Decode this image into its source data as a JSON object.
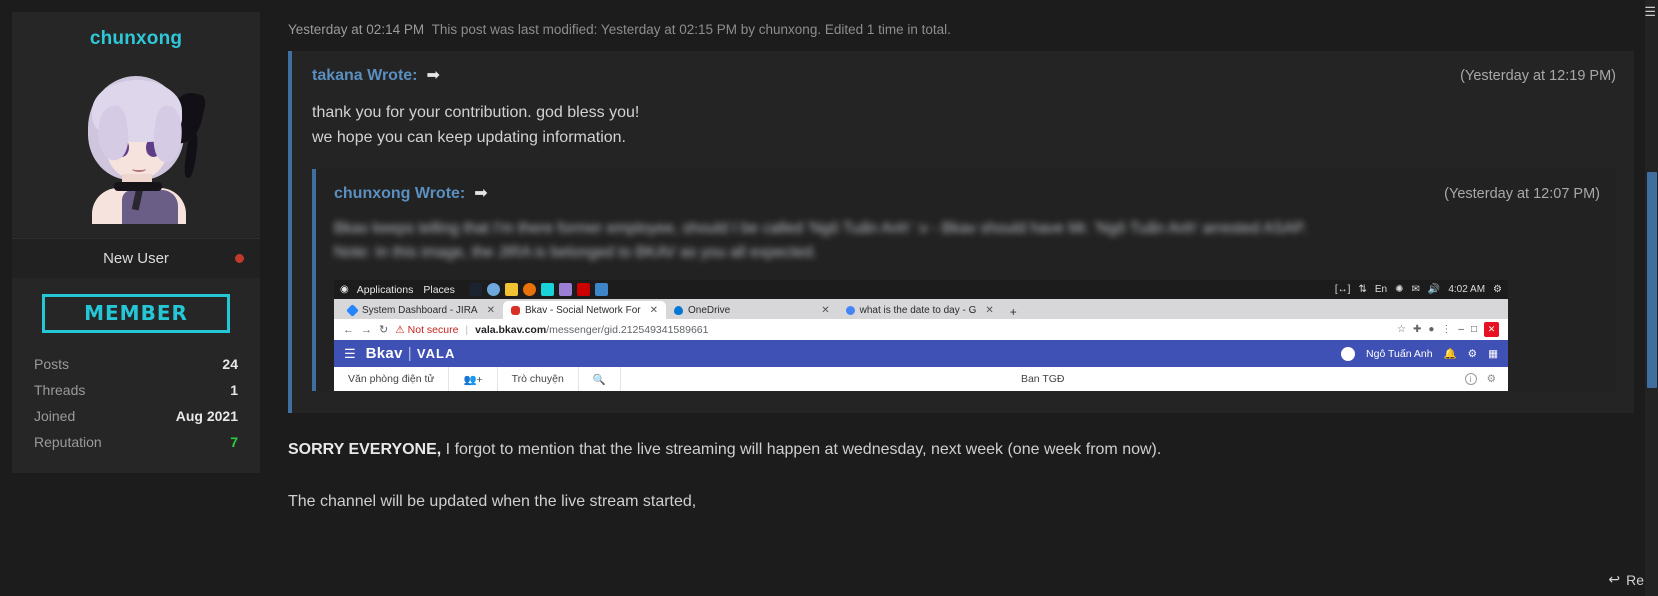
{
  "author": {
    "name": "chunxong",
    "avatar_alt": "anime-girl-avatar",
    "status": "New User",
    "badge": "MEMBER",
    "stats": [
      {
        "label": "Posts",
        "value": "24",
        "kind": "plain"
      },
      {
        "label": "Threads",
        "value": "1",
        "kind": "plain"
      },
      {
        "label": "Joined",
        "value": "Aug 2021",
        "kind": "plain"
      },
      {
        "label": "Reputation",
        "value": "7",
        "kind": "reputation"
      }
    ]
  },
  "post": {
    "timestamp": "Yesterday at 02:14 PM",
    "edit_note": "This post was last modified: Yesterday at 02:15 PM by chunxong. Edited 1 time in total.",
    "paragraphs": [
      {
        "bold": "SORRY EVERYONE,",
        "rest": " I forgot to mention that the live streaming will happen at wednesday, next week (one week from now)."
      },
      {
        "bold": "",
        "rest": "The channel will be updated when the live stream started,"
      }
    ]
  },
  "quote_outer": {
    "author": "takana Wrote:",
    "arrow": "➡",
    "timestamp": "(Yesterday at 12:19 PM)",
    "lines": [
      "thank you for your contribution. god bless you!",
      "we hope you can keep updating information."
    ]
  },
  "quote_inner": {
    "author": "chunxong Wrote:",
    "arrow": "➡",
    "timestamp": "(Yesterday at 12:07 PM)",
    "redacted_lines": [
      "Bkav keeps telling that I'm there former employee, should I be called 'Ngô Tuấn Anh' :v - Bkav should have Mr. 'Ngô Tuấn Anh' arrested ASAP.",
      "Note: In this image, the JIRA is belonged to BKAV as you all expected."
    ]
  },
  "screenshot": {
    "desktop_panel": {
      "activities": "Applications",
      "places": "Places",
      "clock": "4:02 AM",
      "keyboard": "En",
      "tray_icons": [
        "resize-icon",
        "network-icon",
        "bluetooth-icon",
        "mail-icon",
        "volume-icon",
        "power-icon"
      ]
    },
    "browser_tabs": [
      {
        "title": "System Dashboard - JIRA",
        "favicon": "#2684ff",
        "active": false
      },
      {
        "title": "Bkav - Social Network For",
        "favicon": "#d93025",
        "active": true
      },
      {
        "title": "OneDrive",
        "favicon": "#0078d4",
        "active": false
      },
      {
        "title": "what is the date to day - G",
        "favicon": "#4285f4",
        "active": false
      }
    ],
    "new_tab_label": "+",
    "address_bar": {
      "security_label": "Not secure",
      "domain": "vala.bkav.com",
      "path": "/messenger/gid.212549341589661"
    },
    "window_controls": {
      "minimize": "–",
      "maximize": "□",
      "close": "✕"
    },
    "vala": {
      "brand": "Bkav",
      "brand_sub": "VALA",
      "user": "Ngô Tuấn Anh",
      "nav": [
        {
          "label": "Văn phòng điện tử"
        },
        {
          "label": "Trò chuyện"
        },
        {
          "label": "Ban TGĐ"
        }
      ]
    }
  },
  "reply": {
    "label": "Re",
    "icon": "reply-arrow-icon"
  },
  "colors": {
    "accent_cyan": "#25c6d6",
    "quote_bar": "#3f6f9e",
    "link_blue": "#5a8fc0",
    "reputation_green": "#2ecc40",
    "status_red": "#c0392b",
    "vala_indigo": "#3f51b5"
  }
}
